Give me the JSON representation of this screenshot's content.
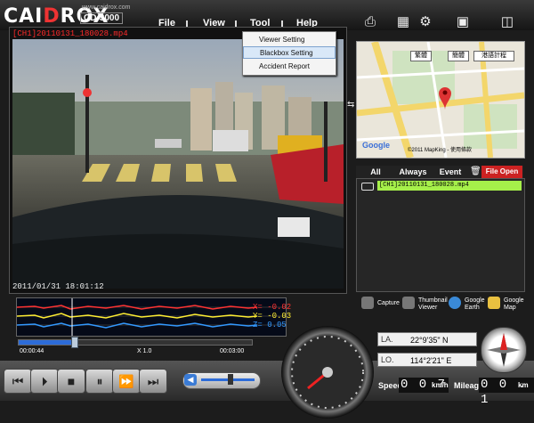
{
  "app": {
    "logo": "CAIDROX",
    "site": "www.caidrox.com",
    "model": "CD-3000"
  },
  "menu": {
    "file": "File",
    "view": "View",
    "tool": "Tool",
    "help": "Help"
  },
  "tool_menu": {
    "items": [
      "Viewer Setting",
      "Blackbox Setting",
      "Accident Report"
    ],
    "highlighted": "Blackbox Setting"
  },
  "video": {
    "file_label": "[CH1]20110131_180028.mp4",
    "timestamp": "2011/01/31 18:01:12"
  },
  "map": {
    "lang_buttons": [
      "繁體",
      "簡體",
      "港語計程"
    ],
    "copyright": "©2011 MapKing - 使用條款",
    "logo": "Google"
  },
  "tabs": {
    "all": "All",
    "always": "Always",
    "event": "Event",
    "file_open": "File Open"
  },
  "file_list": [
    {
      "name": "[CH1]20110131_180028.mp4"
    }
  ],
  "tools": {
    "capture": "Capture",
    "thumbnail": "Thumbnail Viewer",
    "google_earth": "Google Earth",
    "google_map": "Google Map"
  },
  "gsensor": {
    "x": "X= -0.02",
    "y": "Y= -0.03",
    "z": "Z= 0.05"
  },
  "playback": {
    "current": "00:00:44",
    "speed": "X 1.0",
    "total": "00:03:00",
    "progress": 0.24
  },
  "volume": {
    "level": 0.55
  },
  "gps": {
    "lat_label": "LA.",
    "lat": "22°9'35\" N",
    "lon_label": "LO.",
    "lon": "114°2'21\" E"
  },
  "speed": {
    "label": "Speed",
    "value": "0 0 7",
    "unit": "km/h"
  },
  "mileage": {
    "label": "Mileage",
    "value": "0 0 . 1",
    "unit": "km"
  },
  "colors": {
    "accent": "#cc2222",
    "list_row": "#a6f04a",
    "graph_x": "#ff3333",
    "graph_y": "#ffee33",
    "graph_z": "#3399ff"
  }
}
